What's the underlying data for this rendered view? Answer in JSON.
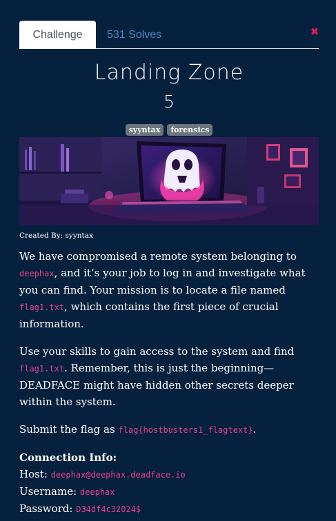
{
  "tabs": {
    "challenge": "Challenge",
    "solves": "531 Solves"
  },
  "close_glyph": "✖",
  "challenge": {
    "name": "Landing Zone",
    "value": "5",
    "tags": [
      "syyntax",
      "forensics"
    ],
    "created_by": "Created By: syyntax"
  },
  "description": {
    "p1_a": "We have compromised a remote system belonging to ",
    "p1_user": "deephax",
    "p1_b": ", and it’s your job to log in and investigate what you can find. Your mission is to locate a file named ",
    "p1_file": "flag1.txt",
    "p1_c": ", which contains the first piece of crucial information.",
    "p2_a": "Use your skills to gain access to the system and find ",
    "p2_file": "flag1.txt",
    "p2_b": ". Remember, this is just the beginning—DEADFACE might have hidden other secrets deeper within the system.",
    "p3_a": "Submit the flag as ",
    "p3_flag": "flag{hostbusters1_flagtext}",
    "p3_b": "."
  },
  "connection": {
    "title": "Connection Info:",
    "host_label": "Host: ",
    "host_value": "deephax@deephax.deadface.io",
    "username_label": "Username: ",
    "username_value": "deephax",
    "password_label": "Password: ",
    "password_value": "D34df4c32024$"
  },
  "colors": {
    "background": "#06213d",
    "tab_link": "#4d88c6",
    "code": "#e83e8c",
    "close": "#e31a5a",
    "tag": "#6c757d"
  }
}
